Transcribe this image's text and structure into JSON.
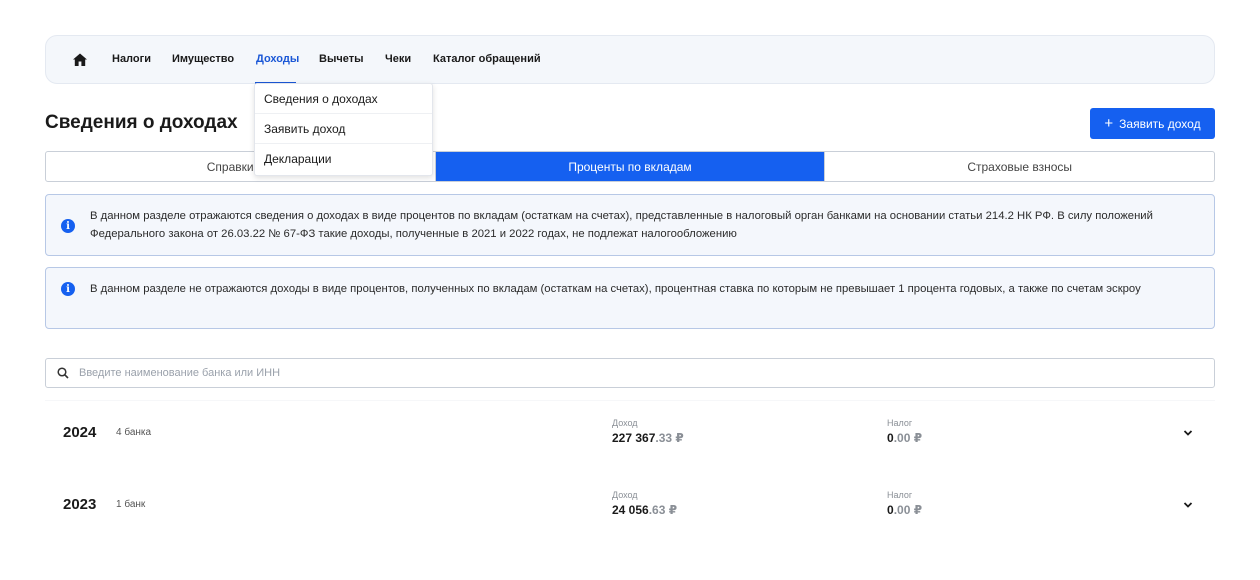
{
  "nav": {
    "items": [
      "Налоги",
      "Имущество",
      "Доходы",
      "Вычеты",
      "Чеки",
      "Каталог обращений"
    ]
  },
  "dropdown": {
    "items": [
      "Сведения о доходах",
      "Заявить доход",
      "Декларации"
    ]
  },
  "page": {
    "title": "Сведения о доходах",
    "declare_button": "Заявить доход"
  },
  "tabs": [
    "Справки о д",
    "Проценты по вкладам",
    "Страховые взносы"
  ],
  "info": {
    "first": "В данном разделе отражаются сведения о доходах в виде процентов по вкладам (остаткам на счетах), представленные в налоговый орган банками на основании статьи 214.2 НК РФ. В силу положений Федерального закона от 26.03.22 № 67-ФЗ такие доходы, полученные в 2021 и 2022 годах, не подлежат налогообложению",
    "second": "В данном разделе не отражаются доходы в виде процентов, полученных по вкладам (остаткам на счетах), процентная ставка по которым не превышает 1 процента годовых, а также по счетам эскроу"
  },
  "search": {
    "placeholder": "Введите наименование банка или ИНН"
  },
  "rows": [
    {
      "year": "2024",
      "banks": "4 банка",
      "income_label": "Доход",
      "income_int": "227 367",
      "income_frac": ".33 ₽",
      "tax_label": "Налог",
      "tax_int": "0",
      "tax_frac": ".00 ₽"
    },
    {
      "year": "2023",
      "banks": "1 банк",
      "income_label": "Доход",
      "income_int": "24 056",
      "income_frac": ".63 ₽",
      "tax_label": "Налог",
      "tax_int": "0",
      "tax_frac": ".00 ₽"
    }
  ],
  "colors": {
    "accent": "#1560f0",
    "nav_active": "#1a57d6"
  },
  "icons": [
    "home-icon",
    "plus-icon",
    "info-icon",
    "search-icon",
    "chevron-down-icon"
  ]
}
